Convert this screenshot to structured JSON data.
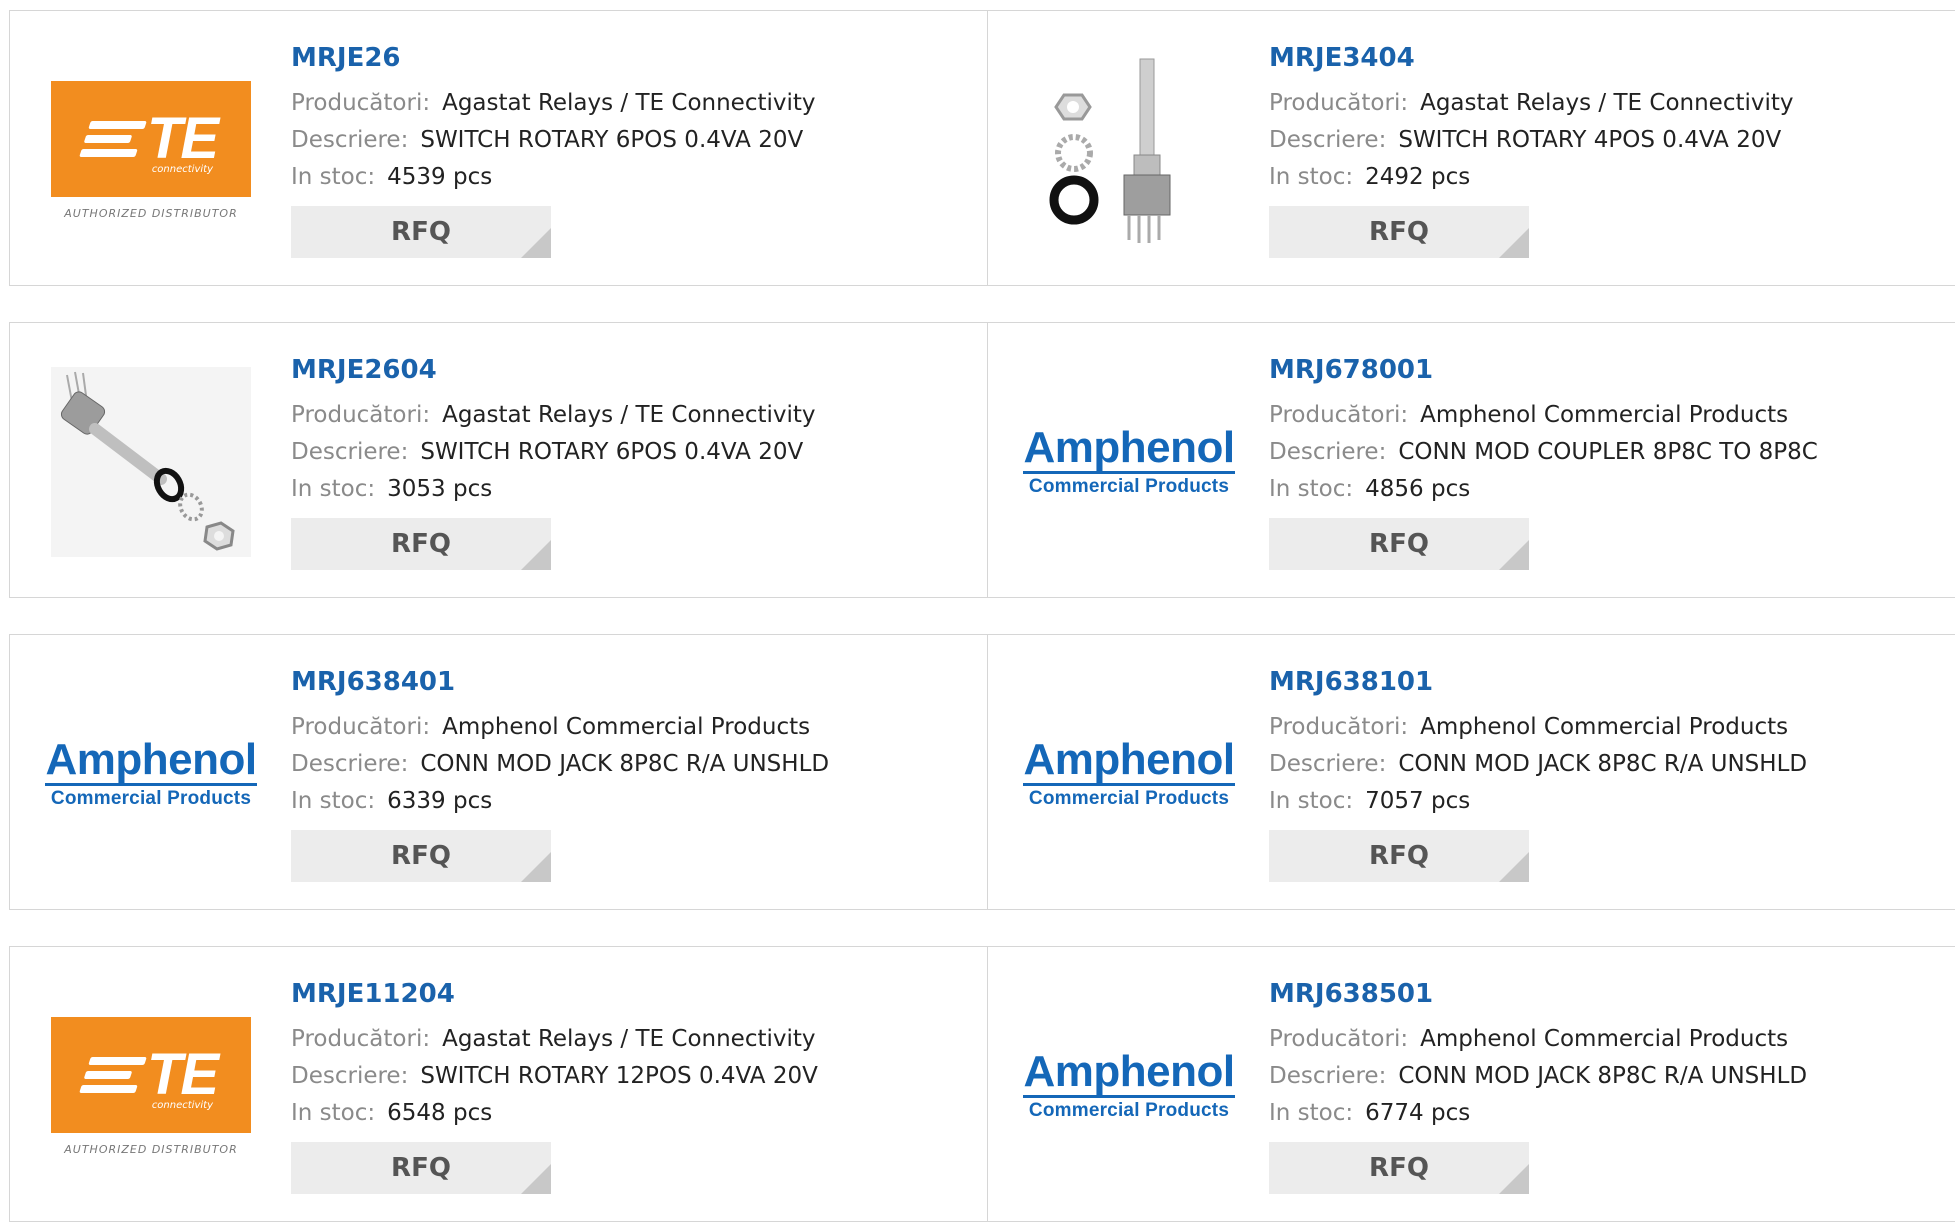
{
  "labels": {
    "manufacturer": "Producători:",
    "description": "Descriere:",
    "stock": "In stoc:",
    "rfq": "RFQ"
  },
  "logos": {
    "te": {
      "main": "TE",
      "sub": "connectivity",
      "tag": "AUTHORIZED DISTRIBUTOR"
    },
    "amphenol": {
      "main": "Amphenol",
      "sub": "Commercial Products"
    }
  },
  "products": [
    {
      "pn": "MRJE26",
      "manufacturer": "Agastat Relays / TE Connectivity",
      "description": "SWITCH ROTARY 6POS 0.4VA 20V",
      "stock": "4539 pcs",
      "image": "te-logo"
    },
    {
      "pn": "MRJE3404",
      "manufacturer": "Agastat Relays / TE Connectivity",
      "description": "SWITCH ROTARY 4POS 0.4VA 20V",
      "stock": "2492 pcs",
      "image": "rotary-switch-upright"
    },
    {
      "pn": "MRJE2604",
      "manufacturer": "Agastat Relays / TE Connectivity",
      "description": "SWITCH ROTARY 6POS 0.4VA 20V",
      "stock": "3053 pcs",
      "image": "rotary-switch-diagonal"
    },
    {
      "pn": "MRJ678001",
      "manufacturer": "Amphenol Commercial Products",
      "description": "CONN MOD COUPLER 8P8C TO 8P8C",
      "stock": "4856 pcs",
      "image": "amphenol-logo"
    },
    {
      "pn": "MRJ638401",
      "manufacturer": "Amphenol Commercial Products",
      "description": "CONN MOD JACK 8P8C R/A UNSHLD",
      "stock": "6339 pcs",
      "image": "amphenol-logo"
    },
    {
      "pn": "MRJ638101",
      "manufacturer": "Amphenol Commercial Products",
      "description": "CONN MOD JACK 8P8C R/A UNSHLD",
      "stock": "7057 pcs",
      "image": "amphenol-logo"
    },
    {
      "pn": "MRJE11204",
      "manufacturer": "Agastat Relays / TE Connectivity",
      "description": "SWITCH ROTARY 12POS 0.4VA 20V",
      "stock": "6548 pcs",
      "image": "te-logo"
    },
    {
      "pn": "MRJ638501",
      "manufacturer": "Amphenol Commercial Products",
      "description": "CONN MOD JACK 8P8C R/A UNSHLD",
      "stock": "6774 pcs",
      "image": "amphenol-logo"
    }
  ],
  "colors": {
    "part_number": "#1a62ab",
    "te_orange": "#f28d1f",
    "amphenol_blue": "#1467b8",
    "rfq_bg": "#ececec"
  }
}
